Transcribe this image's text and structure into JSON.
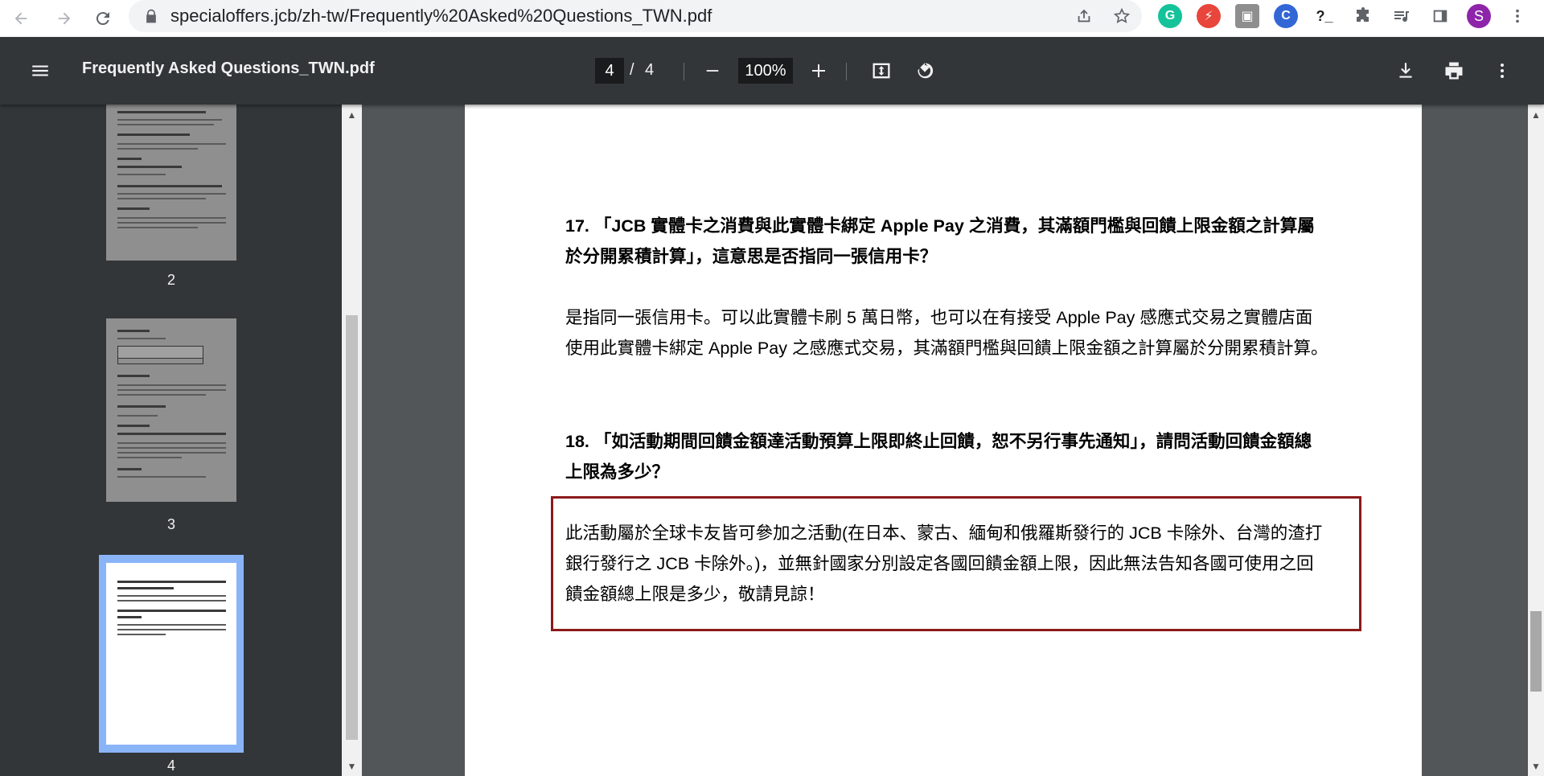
{
  "browser": {
    "url": "specialoffers.jcb/zh-tw/Frequently%20Asked%20Questions_TWN.pdf",
    "profile_initial": "S",
    "extension_initial": "?_",
    "icons": [
      "back-icon",
      "forward-icon",
      "reload-icon",
      "lock-icon",
      "share-icon",
      "star-icon",
      "grammarly-icon",
      "extension-icon",
      "puzzle-icon",
      "reading-list-icon",
      "side-panel-icon",
      "menu-icon"
    ]
  },
  "toolbar": {
    "title": "Frequently Asked Questions_TWN.pdf",
    "page_current": "4",
    "page_separator": "/",
    "page_total": "4",
    "zoom": "100%"
  },
  "sidebar": {
    "thumbnails": [
      {
        "label": "2",
        "selected": false
      },
      {
        "label": "3",
        "selected": false
      },
      {
        "label": "4",
        "selected": true
      }
    ]
  },
  "document": {
    "q17_line1": "17. 「JCB 實體卡之消費與此實體卡綁定 Apple Pay 之消費，其滿額門檻與回饋上限金額之計算屬",
    "q17_line2": "於分開累積計算」，這意思是否指同一張信用卡？",
    "a17_line1": "是指同一張信用卡。可以此實體卡刷 5 萬日幣，也可以在有接受 Apple Pay 感應式交易之實體店面",
    "a17_line2": "使用此實體卡綁定 Apple Pay 之感應式交易，其滿額門檻與回饋上限金額之計算屬於分開累積計算。",
    "q18_line1": "18. 「如活動期間回饋金額達活動預算上限即終止回饋，恕不另行事先通知」，請問活動回饋金額總",
    "q18_line2": "上限為多少？",
    "a18_line1": "此活動屬於全球卡友皆可參加之活動(在日本、蒙古、緬甸和俄羅斯發行的 JCB 卡除外、台灣的渣打",
    "a18_line2": "銀行發行之 JCB 卡除外。)，並無針國家分別設定各國回饋金額上限，因此無法告知各國可使用之回",
    "a18_line3": "饋金額總上限是多少，敬請見諒！"
  },
  "colors": {
    "toolbar_bg": "#323639",
    "viewer_bg": "#525659",
    "highlight_border": "#8b1a1a",
    "thumb_selected": "#8ab4f8"
  }
}
